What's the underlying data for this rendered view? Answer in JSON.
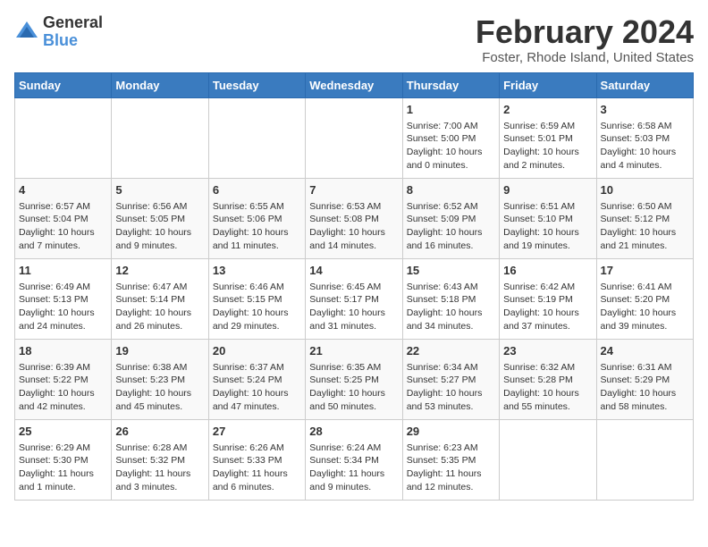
{
  "header": {
    "logo": {
      "general": "General",
      "blue": "Blue"
    },
    "title": "February 2024",
    "subtitle": "Foster, Rhode Island, United States"
  },
  "calendar": {
    "weekdays": [
      "Sunday",
      "Monday",
      "Tuesday",
      "Wednesday",
      "Thursday",
      "Friday",
      "Saturday"
    ],
    "weeks": [
      [
        {
          "day": "",
          "info": ""
        },
        {
          "day": "",
          "info": ""
        },
        {
          "day": "",
          "info": ""
        },
        {
          "day": "",
          "info": ""
        },
        {
          "day": "1",
          "info": "Sunrise: 7:00 AM\nSunset: 5:00 PM\nDaylight: 10 hours\nand 0 minutes."
        },
        {
          "day": "2",
          "info": "Sunrise: 6:59 AM\nSunset: 5:01 PM\nDaylight: 10 hours\nand 2 minutes."
        },
        {
          "day": "3",
          "info": "Sunrise: 6:58 AM\nSunset: 5:03 PM\nDaylight: 10 hours\nand 4 minutes."
        }
      ],
      [
        {
          "day": "4",
          "info": "Sunrise: 6:57 AM\nSunset: 5:04 PM\nDaylight: 10 hours\nand 7 minutes."
        },
        {
          "day": "5",
          "info": "Sunrise: 6:56 AM\nSunset: 5:05 PM\nDaylight: 10 hours\nand 9 minutes."
        },
        {
          "day": "6",
          "info": "Sunrise: 6:55 AM\nSunset: 5:06 PM\nDaylight: 10 hours\nand 11 minutes."
        },
        {
          "day": "7",
          "info": "Sunrise: 6:53 AM\nSunset: 5:08 PM\nDaylight: 10 hours\nand 14 minutes."
        },
        {
          "day": "8",
          "info": "Sunrise: 6:52 AM\nSunset: 5:09 PM\nDaylight: 10 hours\nand 16 minutes."
        },
        {
          "day": "9",
          "info": "Sunrise: 6:51 AM\nSunset: 5:10 PM\nDaylight: 10 hours\nand 19 minutes."
        },
        {
          "day": "10",
          "info": "Sunrise: 6:50 AM\nSunset: 5:12 PM\nDaylight: 10 hours\nand 21 minutes."
        }
      ],
      [
        {
          "day": "11",
          "info": "Sunrise: 6:49 AM\nSunset: 5:13 PM\nDaylight: 10 hours\nand 24 minutes."
        },
        {
          "day": "12",
          "info": "Sunrise: 6:47 AM\nSunset: 5:14 PM\nDaylight: 10 hours\nand 26 minutes."
        },
        {
          "day": "13",
          "info": "Sunrise: 6:46 AM\nSunset: 5:15 PM\nDaylight: 10 hours\nand 29 minutes."
        },
        {
          "day": "14",
          "info": "Sunrise: 6:45 AM\nSunset: 5:17 PM\nDaylight: 10 hours\nand 31 minutes."
        },
        {
          "day": "15",
          "info": "Sunrise: 6:43 AM\nSunset: 5:18 PM\nDaylight: 10 hours\nand 34 minutes."
        },
        {
          "day": "16",
          "info": "Sunrise: 6:42 AM\nSunset: 5:19 PM\nDaylight: 10 hours\nand 37 minutes."
        },
        {
          "day": "17",
          "info": "Sunrise: 6:41 AM\nSunset: 5:20 PM\nDaylight: 10 hours\nand 39 minutes."
        }
      ],
      [
        {
          "day": "18",
          "info": "Sunrise: 6:39 AM\nSunset: 5:22 PM\nDaylight: 10 hours\nand 42 minutes."
        },
        {
          "day": "19",
          "info": "Sunrise: 6:38 AM\nSunset: 5:23 PM\nDaylight: 10 hours\nand 45 minutes."
        },
        {
          "day": "20",
          "info": "Sunrise: 6:37 AM\nSunset: 5:24 PM\nDaylight: 10 hours\nand 47 minutes."
        },
        {
          "day": "21",
          "info": "Sunrise: 6:35 AM\nSunset: 5:25 PM\nDaylight: 10 hours\nand 50 minutes."
        },
        {
          "day": "22",
          "info": "Sunrise: 6:34 AM\nSunset: 5:27 PM\nDaylight: 10 hours\nand 53 minutes."
        },
        {
          "day": "23",
          "info": "Sunrise: 6:32 AM\nSunset: 5:28 PM\nDaylight: 10 hours\nand 55 minutes."
        },
        {
          "day": "24",
          "info": "Sunrise: 6:31 AM\nSunset: 5:29 PM\nDaylight: 10 hours\nand 58 minutes."
        }
      ],
      [
        {
          "day": "25",
          "info": "Sunrise: 6:29 AM\nSunset: 5:30 PM\nDaylight: 11 hours\nand 1 minute."
        },
        {
          "day": "26",
          "info": "Sunrise: 6:28 AM\nSunset: 5:32 PM\nDaylight: 11 hours\nand 3 minutes."
        },
        {
          "day": "27",
          "info": "Sunrise: 6:26 AM\nSunset: 5:33 PM\nDaylight: 11 hours\nand 6 minutes."
        },
        {
          "day": "28",
          "info": "Sunrise: 6:24 AM\nSunset: 5:34 PM\nDaylight: 11 hours\nand 9 minutes."
        },
        {
          "day": "29",
          "info": "Sunrise: 6:23 AM\nSunset: 5:35 PM\nDaylight: 11 hours\nand 12 minutes."
        },
        {
          "day": "",
          "info": ""
        },
        {
          "day": "",
          "info": ""
        }
      ]
    ]
  }
}
